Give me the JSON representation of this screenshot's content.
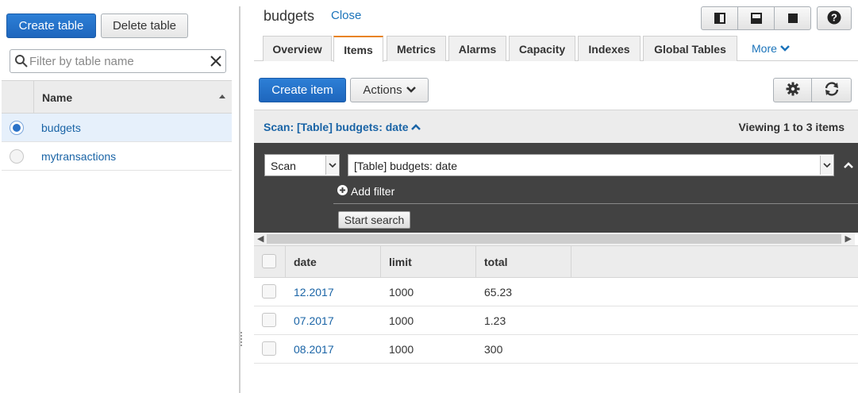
{
  "left": {
    "create_table": "Create table",
    "delete_table": "Delete table",
    "filter_placeholder": "Filter by table name",
    "name_header": "Name",
    "tables": [
      {
        "name": "budgets",
        "selected": true
      },
      {
        "name": "mytransactions",
        "selected": false
      }
    ]
  },
  "header": {
    "title": "budgets",
    "close_label": "Close"
  },
  "tabs": [
    "Overview",
    "Items",
    "Metrics",
    "Alarms",
    "Capacity",
    "Indexes",
    "Global Tables"
  ],
  "active_tab": "Items",
  "more_label": "More",
  "toolbar": {
    "create_item": "Create item",
    "actions": "Actions"
  },
  "scan": {
    "summary": "Scan: [Table] budgets: date",
    "viewing": "Viewing 1 to 3 items",
    "mode_value": "Scan",
    "target_value": "[Table] budgets: date",
    "add_filter": "Add filter",
    "start_search": "Start search"
  },
  "grid": {
    "columns": [
      "date",
      "limit",
      "total"
    ],
    "rows": [
      {
        "date": "12.2017",
        "limit": "1000",
        "total": "65.23"
      },
      {
        "date": "07.2017",
        "limit": "1000",
        "total": "1.23"
      },
      {
        "date": "08.2017",
        "limit": "1000",
        "total": "300"
      }
    ]
  },
  "colors": {
    "primary": "#1e66bd",
    "link": "#1a64a6",
    "active_tab_accent": "#e8831e",
    "dark_panel": "#424242"
  }
}
